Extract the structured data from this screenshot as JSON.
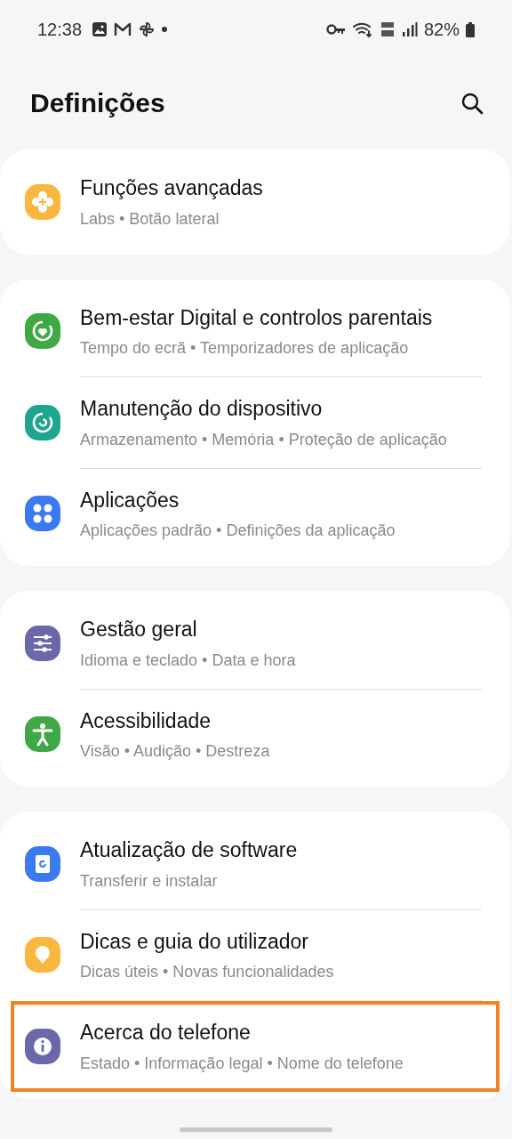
{
  "status_bar": {
    "time": "12:38",
    "battery": "82%"
  },
  "header": {
    "title": "Definições"
  },
  "groups": [
    {
      "items": [
        {
          "title": "Funções avançadas",
          "subtitle": "Labs • Botão lateral",
          "color": "#f9b740",
          "highlighted": false
        }
      ]
    },
    {
      "items": [
        {
          "title": "Bem-estar Digital e controlos parentais",
          "subtitle": "Tempo do ecrã • Temporizadores de aplicação",
          "color": "#3fa845",
          "highlighted": false
        },
        {
          "title": "Manutenção do dispositivo",
          "subtitle": "Armazenamento • Memória • Proteção de aplicação",
          "color": "#1fa58f",
          "highlighted": false
        },
        {
          "title": "Aplicações",
          "subtitle": "Aplicações padrão • Definições da aplicação",
          "color": "#3b79f0",
          "highlighted": false
        }
      ]
    },
    {
      "items": [
        {
          "title": "Gestão geral",
          "subtitle": "Idioma e teclado • Data e hora",
          "color": "#6a68a8",
          "highlighted": false
        },
        {
          "title": "Acessibilidade",
          "subtitle": "Visão • Audição • Destreza",
          "color": "#3fa845",
          "highlighted": false
        }
      ]
    },
    {
      "items": [
        {
          "title": "Atualização de software",
          "subtitle": "Transferir e instalar",
          "color": "#3b79f0",
          "highlighted": false
        },
        {
          "title": "Dicas e guia do utilizador",
          "subtitle": "Dicas úteis • Novas funcionalidades",
          "color": "#f9b740",
          "highlighted": false
        },
        {
          "title": "Acerca do telefone",
          "subtitle": "Estado • Informação legal • Nome do telefone",
          "color": "#6a68a8",
          "highlighted": true
        }
      ]
    }
  ]
}
